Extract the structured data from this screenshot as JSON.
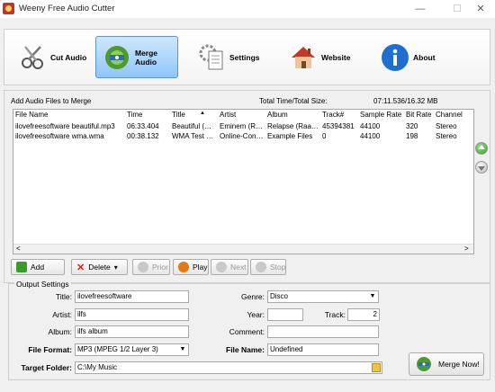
{
  "window": {
    "title": "Weeny Free Audio Cutter",
    "minimize": "—",
    "maximize": "☐",
    "close": "✕"
  },
  "toolbar": {
    "cut_audio": "Cut Audio",
    "merge_audio": "Merge Audio",
    "settings": "Settings",
    "website": "Website",
    "about": "About"
  },
  "merge_panel": {
    "heading": "Add Audio Files to Merge",
    "total_label": "Total Time/Total Size:",
    "total_value": "07:11.536/16.32 MB",
    "columns": [
      "File Name",
      "Time",
      "Title",
      "Artist",
      "Album",
      "Track#",
      "Sample Rate",
      "Bit Rate",
      "Channel"
    ],
    "sort_indicator": "▲",
    "rows": [
      [
        "ilovefreesoftware beautiful.mp3",
        "06:33.404",
        "Beautiful (…",
        "Eminem (R…",
        "Relapse (Raa…",
        "45394381",
        "44100",
        "320",
        "Stereo"
      ],
      [
        "ilovefreesoftware wma.wma",
        "00:38.132",
        "WMA Test …",
        "Online-Con…",
        "Example Files",
        "0",
        "44100",
        "198",
        "Stereo"
      ]
    ],
    "scroll_left": "<",
    "scroll_right": ">"
  },
  "actions": {
    "add": "Add",
    "delete": "Delete",
    "delete_arrow": "▾",
    "prior": "Prior",
    "play": "Play",
    "next": "Next",
    "stop": "Stop"
  },
  "output": {
    "group_title": "Output Settings",
    "title_label": "Title:",
    "title_value": "ilovefreesoftware",
    "artist_label": "Artist:",
    "artist_value": "ilfs",
    "album_label": "Album:",
    "album_value": "ilfs album",
    "format_label": "File Format:",
    "format_value": "MP3 (MPEG 1/2 Layer 3)",
    "folder_label": "Target Folder:",
    "folder_value": "C:\\My Music",
    "genre_label": "Genre:",
    "genre_value": "Disco",
    "year_label": "Year:",
    "year_value": "",
    "track_label": "Track:",
    "track_value": "2",
    "comment_label": "Comment:",
    "comment_value": "",
    "filename_label": "File Name:",
    "filename_value": "Undefined",
    "dropdown_arrow": "▼",
    "merge_now": "Merge Now!"
  },
  "colors": {
    "active_tab": "#8fc6f8",
    "panel_bg": "#f0f0f0",
    "play_icon": "#e07a12",
    "delete_x": "#d0241c",
    "add_green": "#3a9a2a"
  }
}
